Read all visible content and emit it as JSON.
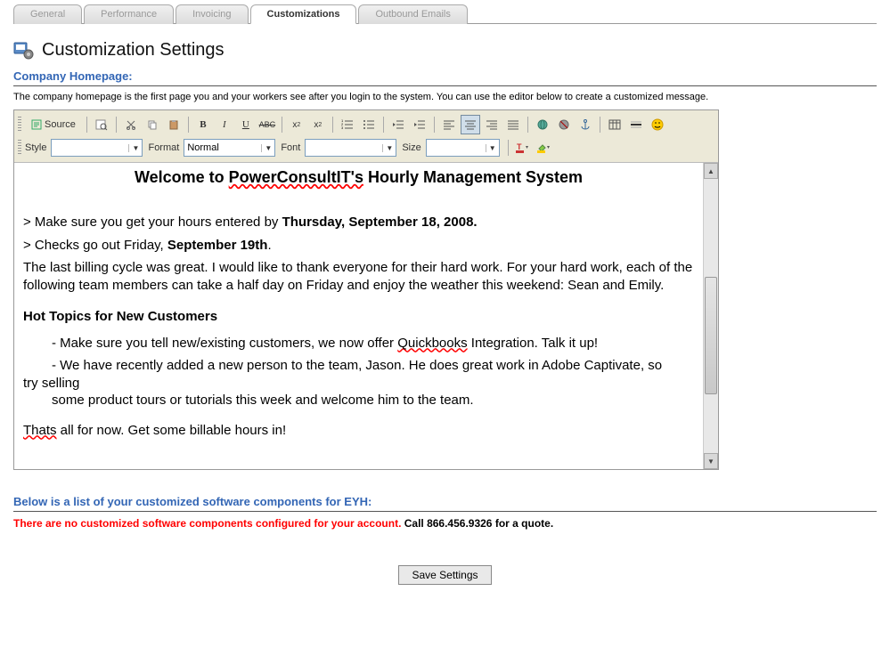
{
  "tabs": [
    {
      "label": "General",
      "active": false
    },
    {
      "label": "Performance",
      "active": false
    },
    {
      "label": "Invoicing",
      "active": false
    },
    {
      "label": "Customizations",
      "active": true
    },
    {
      "label": "Outbound Emails",
      "active": false
    }
  ],
  "page_title": "Customization Settings",
  "section1": {
    "heading": "Company Homepage:",
    "description": "The company homepage is the first page you and your workers see after you login to the system. You can use the editor below to create a customized message."
  },
  "editor": {
    "source_label": "Source",
    "style_label": "Style",
    "style_value": "",
    "format_label": "Format",
    "format_value": "Normal",
    "font_label": "Font",
    "font_value": "",
    "size_label": "Size",
    "size_value": "",
    "content": {
      "heading_pre": "Welcome to ",
      "heading_mid": "PowerConsultIT's",
      "heading_post": " Hourly Management System",
      "line1_pre": "> Make sure you get your hours entered by ",
      "line1_bold": "Thursday, September 18, 2008.",
      "line2_pre": "> Checks go out Friday, ",
      "line2_bold": "September 19th",
      "line2_post": ".",
      "para1": "The last billing cycle was great.  I would like to thank everyone for their hard work.  For your hard work, each of the following team members can take a half day on Friday and enjoy the weather this weekend: Sean and Emily.",
      "topics_heading": "Hot Topics for New Customers",
      "bullet1_a": "- Make sure you tell new/existing customers, we now offer ",
      "bullet1_b": "Quickbooks",
      "bullet1_c": " Integration.  Talk it up!",
      "bullet2_a": "- We have recently added a new person to the team, Jason. He does great work in Adobe Captivate, so",
      "bullet2_b": "try selling",
      "bullet2_c": "some product tours or tutorials this week and welcome him to the team.",
      "closing_a": "Thats",
      "closing_b": " all for now. Get some billable hours in!"
    }
  },
  "section2": {
    "heading": "Below is a list of your customized software components for EYH:",
    "warning_red": "There are no customized software components configured for your account.  ",
    "warning_rest": "Call 866.456.9326 for a quote."
  },
  "save_button": "Save Settings"
}
